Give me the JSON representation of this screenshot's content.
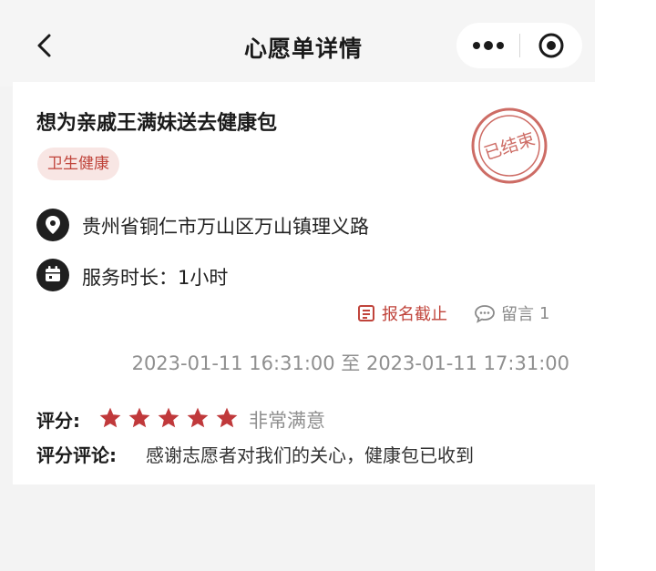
{
  "header": {
    "title": "心愿单详情"
  },
  "wish": {
    "title": "想为亲戚王满妹送去健康包",
    "tag": "卫生健康",
    "stamp_text": "已结束",
    "location": "贵州省铜仁市万山区万山镇理义路",
    "duration_label": "服务时长：",
    "duration_value": "1小时",
    "signup_status": "报名截止",
    "message_label": "留言",
    "message_count": "1",
    "time_range": "2023-01-11 16:31:00 至 2023-01-11 17:31:00"
  },
  "review": {
    "rating_label": "评分:",
    "stars": 5,
    "rating_text": "非常满意",
    "comment_label": "评分评论:",
    "comment_text": "感谢志愿者对我们的关心，健康包已收到"
  },
  "colors": {
    "accent": "#c0443b",
    "star": "#c0393b"
  }
}
